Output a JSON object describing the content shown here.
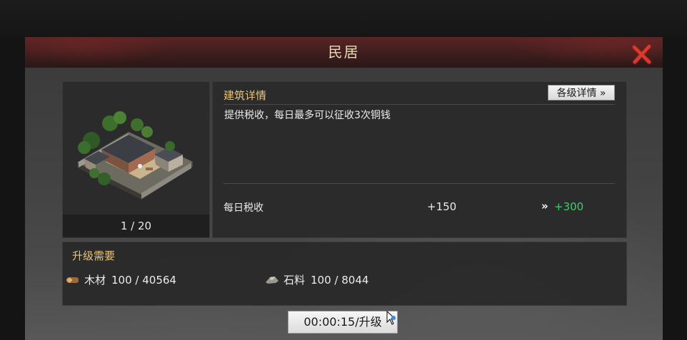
{
  "dialog": {
    "title": "民居"
  },
  "building": {
    "level": "1 / 20"
  },
  "details": {
    "title": "建筑详情",
    "levels_button": "各级详情 »",
    "description": "提供税收，每日最多可以征收3次铜钱",
    "stat_label": "每日税收",
    "stat_current": "+150",
    "stat_arrow": "»",
    "stat_next": "+300"
  },
  "requirements": {
    "title": "升级需要",
    "resources": [
      {
        "icon": "wood-icon",
        "name": "木材",
        "value": "100 / 40564"
      },
      {
        "icon": "stone-icon",
        "name": "石料",
        "value": "100 / 8044"
      }
    ]
  },
  "upgrade": {
    "label": "00:00:15/升级"
  },
  "colors": {
    "gold_heading": "#e8c37a",
    "bonus_green": "#3ecf6a",
    "close_red": "#d83a30"
  }
}
